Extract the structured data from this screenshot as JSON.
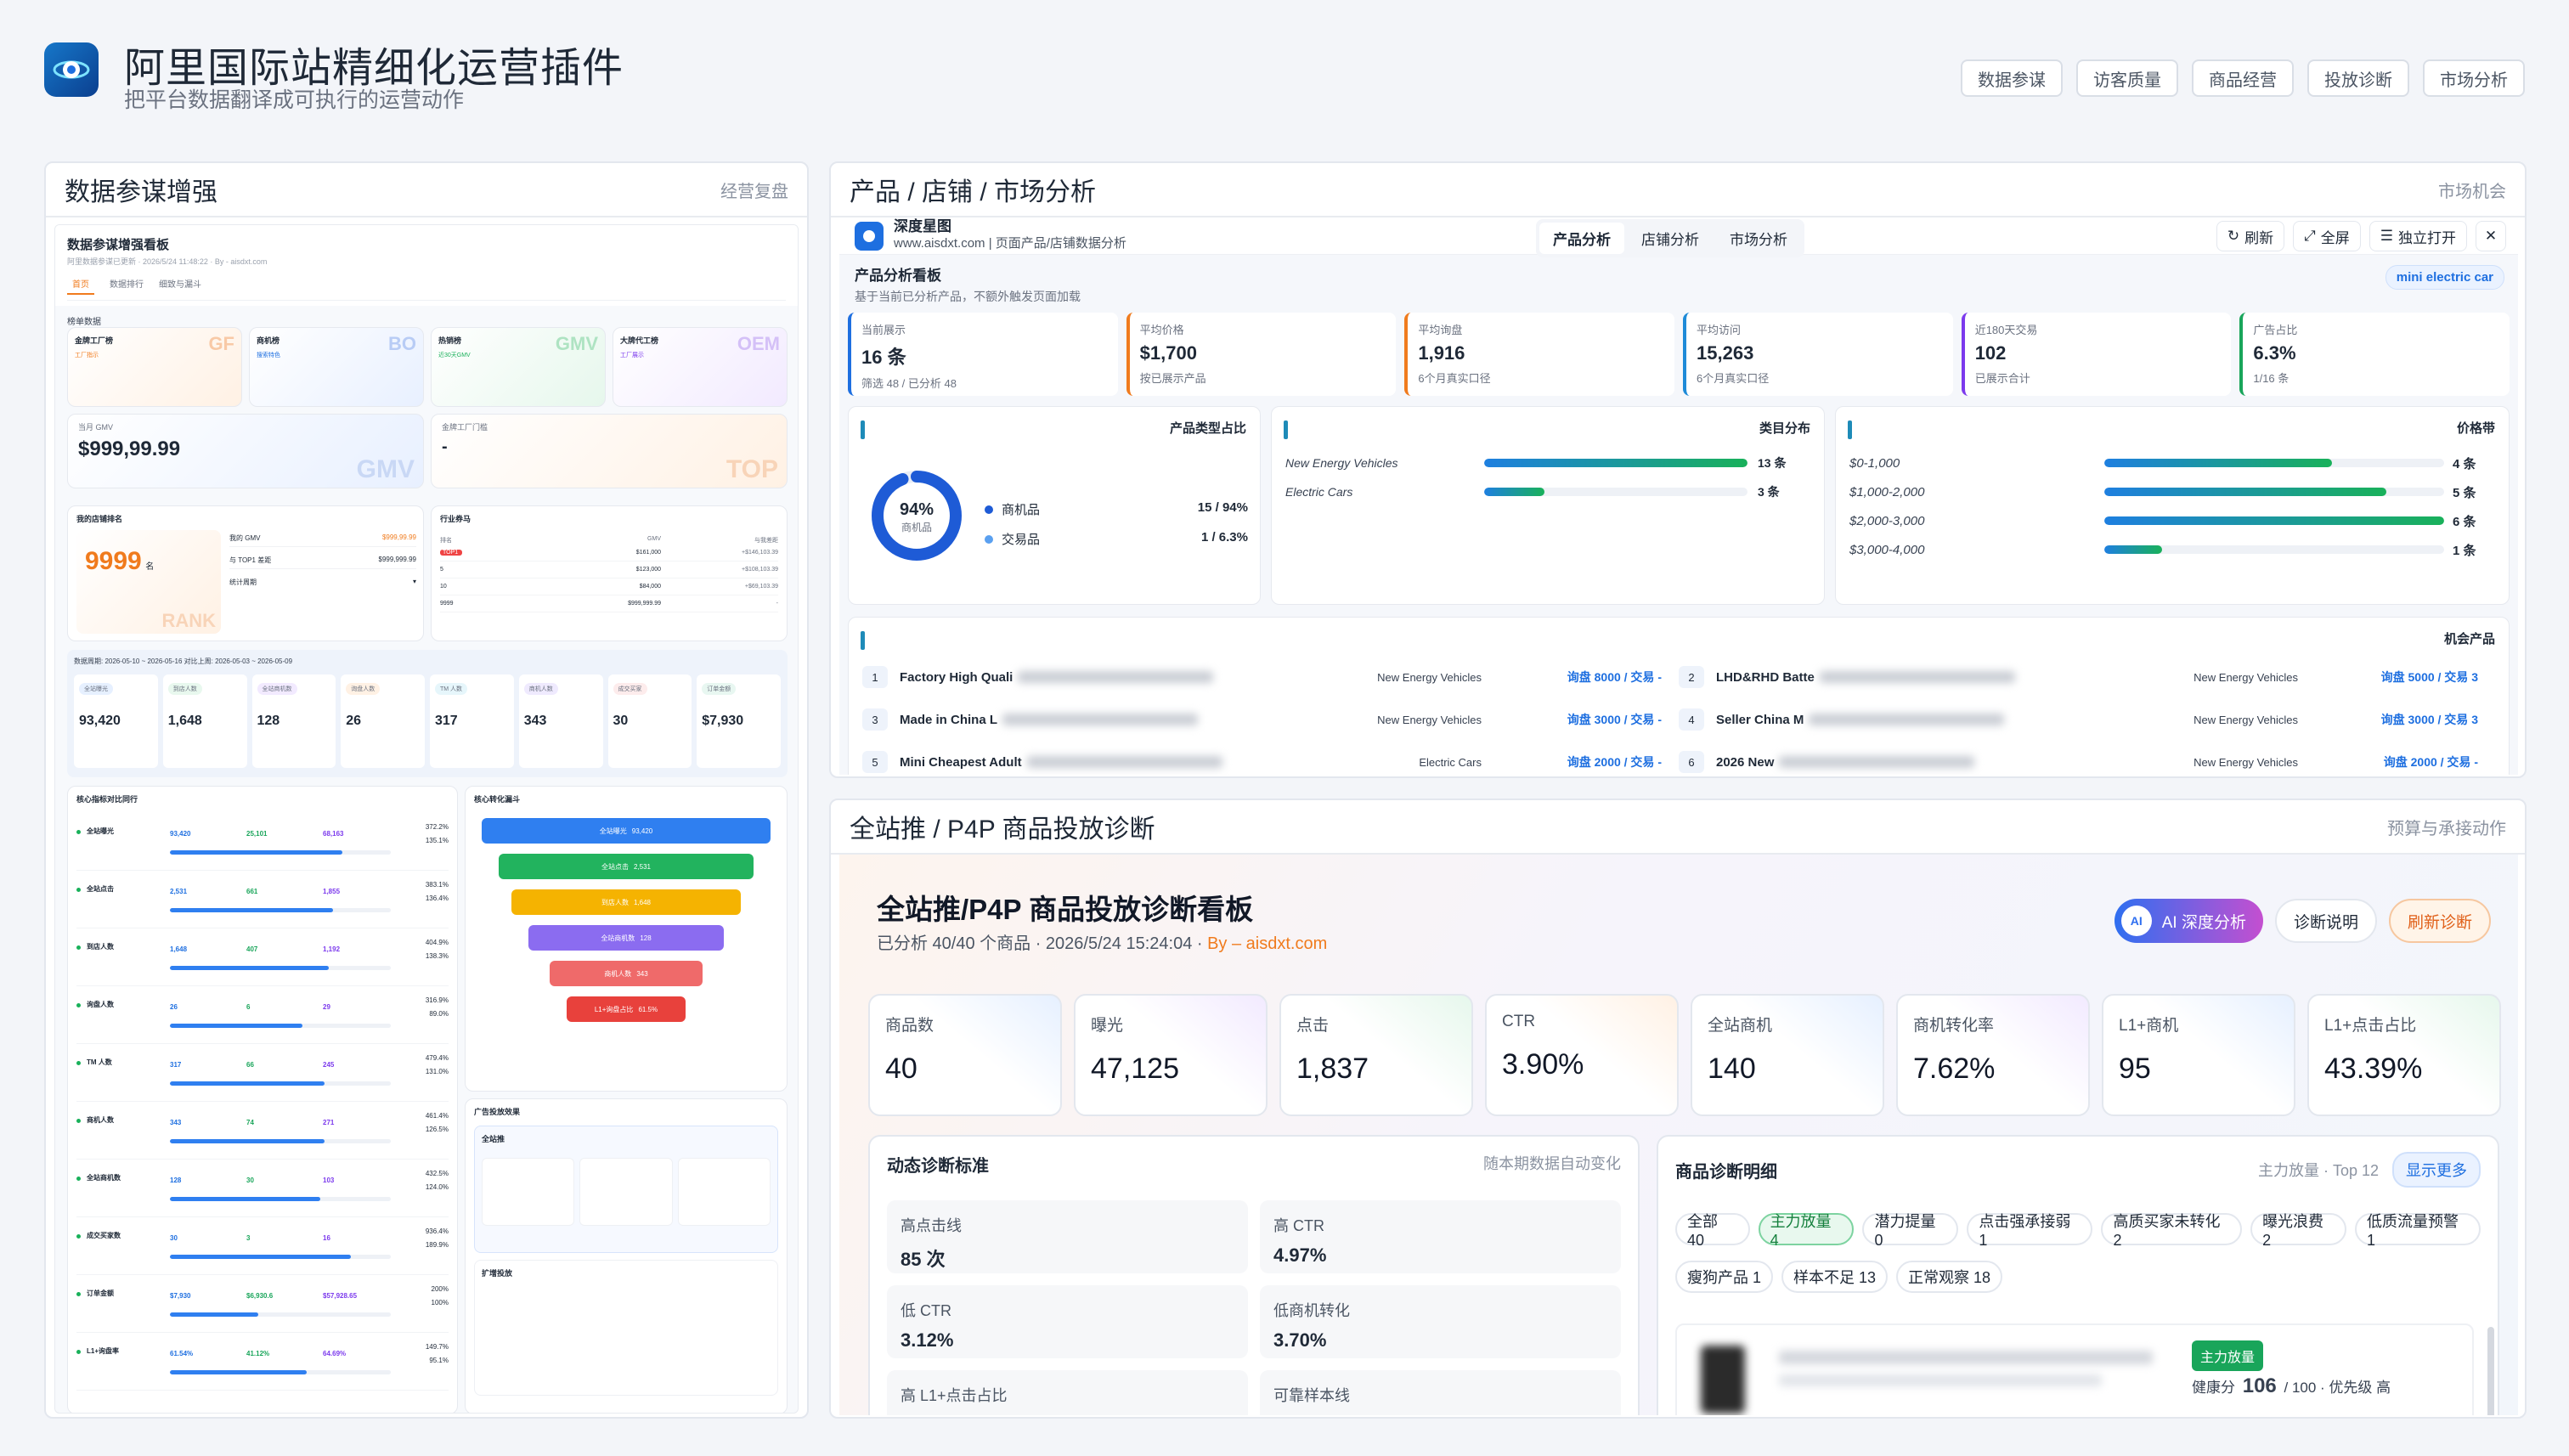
{
  "header": {
    "title": "阿里国际站精细化运营插件",
    "subtitle": "把平台数据翻译成可执行的运营动作",
    "nav": [
      "数据参谋",
      "访客质量",
      "商品经营",
      "投放诊断",
      "市场分析"
    ]
  },
  "left_panel": {
    "title": "数据参谋增强",
    "right": "经营复盘",
    "board_title": "数据参谋增强看板",
    "board_sub": "阿里数据参谋已更新 · 2026/5/24 11:48:22 · By - aisdxt.com",
    "tabs": [
      "首页",
      "数据排行",
      "细致与漏斗"
    ],
    "section_label": "榜单数据",
    "badges": [
      {
        "name": "金牌工厂榜",
        "tag": "工厂指示",
        "wm": "GF"
      },
      {
        "name": "商机榜",
        "tag": "搜索特色",
        "wm": "BO"
      },
      {
        "name": "热销榜",
        "tag": "近30天GMV",
        "wm": "GMV"
      },
      {
        "name": "大牌代工榜",
        "tag": "工厂展示",
        "wm": "OEM"
      }
    ],
    "gmv_label": "当月 GMV",
    "gmv_value": "$999,99.99",
    "gmv_wm": "GMV",
    "factory_label": "金牌工厂门槛",
    "factory_value": "-",
    "factory_wm": "TOP",
    "rank_title": "我的店铺排名",
    "rank_value": "9999",
    "rank_suffix": "名",
    "rank_wm": "RANK",
    "rank_rows": [
      {
        "k": "我的 GMV",
        "v": "$999,99.99"
      },
      {
        "k": "与 TOP1 差距",
        "v": "$999,999.99"
      },
      {
        "k": "统计周期",
        "v": ""
      }
    ],
    "industry_title": "行业券马",
    "industry_head": [
      "排名",
      "GMV",
      "与我差距"
    ],
    "industry_rows": [
      {
        "rank": "TOP1",
        "gmv": "$161,000",
        "diff": "+$146,103.39"
      },
      {
        "rank": "5",
        "gmv": "$123,000",
        "diff": "+$108,103.39"
      },
      {
        "rank": "10",
        "gmv": "$84,000",
        "diff": "+$69,103.39"
      },
      {
        "rank": "9999",
        "gmv": "$999,999.99",
        "diff": "-"
      }
    ],
    "date_range": "数据周期: 2026-05-10 ~ 2026-05-16  对比上周: 2026-05-03 ~ 2026-05-09",
    "mini_kpis": [
      {
        "label": "全站曝光",
        "value": "93,420"
      },
      {
        "label": "到店人数",
        "value": "1,648"
      },
      {
        "label": "全站商机数",
        "value": "128"
      },
      {
        "label": "询盘人数",
        "value": "26"
      },
      {
        "label": "TM 人数",
        "value": "317"
      },
      {
        "label": "商机人数",
        "value": "343"
      },
      {
        "label": "成交买家",
        "value": "30"
      },
      {
        "label": "订单金额",
        "value": "$7,930"
      }
    ],
    "compare_title": "核心指标对比同行",
    "funnel_title": "核心转化漏斗",
    "compare_rows": [
      {
        "name": "全站曝光",
        "me": "93,420",
        "avg": "25,101",
        "top": "68,163",
        "p1": "372.2%",
        "p2": "135.1%",
        "fill": 0.78
      },
      {
        "name": "全站点击",
        "me": "2,531",
        "avg": "661",
        "top": "1,855",
        "p1": "383.1%",
        "p2": "136.4%",
        "fill": 0.74
      },
      {
        "name": "到店人数",
        "me": "1,648",
        "avg": "407",
        "top": "1,192",
        "p1": "404.9%",
        "p2": "138.3%",
        "fill": 0.72
      },
      {
        "name": "询盘人数",
        "me": "26",
        "avg": "6",
        "top": "29",
        "p1": "316.9%",
        "p2": "89.0%",
        "fill": 0.6
      },
      {
        "name": "TM 人数",
        "me": "317",
        "avg": "66",
        "top": "245",
        "p1": "479.4%",
        "p2": "131.0%",
        "fill": 0.7
      },
      {
        "name": "商机人数",
        "me": "343",
        "avg": "74",
        "top": "271",
        "p1": "461.4%",
        "p2": "126.5%",
        "fill": 0.7
      },
      {
        "name": "全站商机数",
        "me": "128",
        "avg": "30",
        "top": "103",
        "p1": "432.5%",
        "p2": "124.0%",
        "fill": 0.68
      },
      {
        "name": "成交买家数",
        "me": "30",
        "avg": "3",
        "top": "16",
        "p1": "936.4%",
        "p2": "189.9%",
        "fill": 0.82
      },
      {
        "name": "订单金额",
        "me": "$7,930",
        "avg": "$6,930.6",
        "top": "$57,928.65",
        "p1": "200%",
        "p2": "100%",
        "fill": 0.4
      },
      {
        "name": "L1+询盘率",
        "me": "61.54%",
        "avg": "41.12%",
        "top": "64.69%",
        "p1": "149.7%",
        "p2": "95.1%",
        "fill": 0.62
      }
    ],
    "funnel": [
      {
        "label": "全站曝光",
        "value": "93,420",
        "color": "#2f7ff0"
      },
      {
        "label": "全站点击",
        "value": "2,531",
        "color": "#22b35e"
      },
      {
        "label": "到店人数",
        "value": "1,648",
        "color": "#f5b301"
      },
      {
        "label": "全站商机数",
        "value": "128",
        "color": "#8b6cf0"
      },
      {
        "label": "商机人数",
        "value": "343",
        "color": "#ef6a6a"
      },
      {
        "label": "L1+询盘占比",
        "value": "61.5%",
        "color": "#e8413c"
      }
    ],
    "ads_title": "广告投放效果",
    "ads_group1": "全站推",
    "ads_group2": "扩增投放"
  },
  "market_panel": {
    "title": "产品 / 店铺 / 市场分析",
    "right": "市场机会",
    "brand": "深度星图",
    "brand_sub": "www.aisdxt.com | 页面产品/店铺数据分析",
    "tabs": [
      "产品分析",
      "店铺分析",
      "市场分析"
    ],
    "actions": [
      "刷新",
      "全屏",
      "独立打开"
    ],
    "close": "✕",
    "board_title": "产品分析看板",
    "board_sub": "基于当前已分析产品，不额外触发页面加载",
    "keyword": "mini electric car",
    "kpis": [
      {
        "label": "当前展示",
        "value": "16 条",
        "sub": "筛选 48 / 已分析 48"
      },
      {
        "label": "平均价格",
        "value": "$1,700",
        "sub": "按已展示产品"
      },
      {
        "label": "平均询盘",
        "value": "1,916",
        "sub": "6个月真实口径"
      },
      {
        "label": "平均访问",
        "value": "15,263",
        "sub": "6个月真实口径"
      },
      {
        "label": "近180天交易",
        "value": "102",
        "sub": "已展示合计"
      },
      {
        "label": "广告占比",
        "value": "6.3%",
        "sub": "1/16 条"
      }
    ],
    "type_title": "产品类型占比",
    "donut_value": "94%",
    "donut_label": "商机品",
    "donut_pct": 0.94,
    "type_legend": [
      {
        "name": "商机品",
        "value": "15 / 94%"
      },
      {
        "name": "交易品",
        "value": "1 / 6.3%"
      }
    ],
    "cat_title": "类目分布",
    "categories": [
      {
        "name": "New Energy Vehicles",
        "value": "13 条",
        "fill": 1.0
      },
      {
        "name": "Electric Cars",
        "value": "3 条",
        "fill": 0.23
      }
    ],
    "price_title": "价格带",
    "price_bands": [
      {
        "name": "$0-1,000",
        "value": "4 条",
        "fill": 0.67
      },
      {
        "name": "$1,000-2,000",
        "value": "5 条",
        "fill": 0.83
      },
      {
        "name": "$2,000-3,000",
        "value": "6 条",
        "fill": 1.0
      },
      {
        "name": "$3,000-4,000",
        "value": "1 条",
        "fill": 0.17
      }
    ],
    "opp_title": "机会产品",
    "opps": [
      {
        "n": "1",
        "name": "Factory High Quali",
        "cat": "New Energy Vehicles",
        "stat": "询盘 8000 / 交易 -"
      },
      {
        "n": "2",
        "name": "LHD&RHD Batte",
        "cat": "New Energy Vehicles",
        "stat": "询盘 5000 / 交易 3"
      },
      {
        "n": "3",
        "name": "Made in China L",
        "cat": "New Energy Vehicles",
        "stat": "询盘 3000 / 交易 -"
      },
      {
        "n": "4",
        "name": "Seller China M",
        "cat": "New Energy Vehicles",
        "stat": "询盘 3000 / 交易 3"
      },
      {
        "n": "5",
        "name": "Mini Cheapest Adult",
        "cat": "Electric Cars",
        "stat": "询盘 2000 / 交易 -"
      },
      {
        "n": "6",
        "name": "2026 New",
        "cat": "New Energy Vehicles",
        "stat": "询盘 2000 / 交易 -"
      }
    ]
  },
  "p4p_panel": {
    "title": "全站推 / P4P 商品投放诊断",
    "right": "预算与承接动作",
    "board_title": "全站推/P4P 商品投放诊断看板",
    "meta_prefix": "已分析 40/40 个商品 · 2026/5/24 15:24:04 · ",
    "meta_by": "By – aisdxt.com",
    "btn_ai_badge": "AI",
    "btn_ai": "AI 深度分析",
    "btn_help": "诊断说明",
    "btn_refresh": "刷新诊断",
    "kpis": [
      {
        "label": "商品数",
        "value": "40"
      },
      {
        "label": "曝光",
        "value": "47,125"
      },
      {
        "label": "点击",
        "value": "1,837"
      },
      {
        "label": "CTR",
        "value": "3.90%"
      },
      {
        "label": "全站商机",
        "value": "140"
      },
      {
        "label": "商机转化率",
        "value": "7.62%"
      },
      {
        "label": "L1+商机",
        "value": "95"
      },
      {
        "label": "L1+点击占比",
        "value": "43.39%"
      }
    ],
    "dyn_title": "动态诊断标准",
    "dyn_right": "随本期数据自动变化",
    "dyn_items": [
      {
        "label": "高点击线",
        "value": "85 次"
      },
      {
        "label": "高 CTR",
        "value": "4.97%"
      },
      {
        "label": "低 CTR",
        "value": "3.12%"
      },
      {
        "label": "低商机转化",
        "value": "3.70%"
      },
      {
        "label": "高 L1+点击占比",
        "value": ""
      },
      {
        "label": "可靠样本线",
        "value": ""
      }
    ],
    "detail_title": "商品诊断明细",
    "detail_right": "主力放量 · Top 12",
    "detail_more": "显示更多",
    "chips_row1": [
      {
        "label": "全部 40",
        "active": false
      },
      {
        "label": "主力放量 4",
        "active": true
      },
      {
        "label": "潜力提量 0",
        "active": false
      },
      {
        "label": "点击强承接弱 1",
        "active": false
      },
      {
        "label": "高质买家未转化 2",
        "active": false
      },
      {
        "label": "曝光浪费 2",
        "active": false
      },
      {
        "label": "低质流量预警 1",
        "active": false
      }
    ],
    "chips_row2": [
      {
        "label": "瘦狗产品 1",
        "active": false
      },
      {
        "label": "样本不足 13",
        "active": false
      },
      {
        "label": "正常观察 18",
        "active": false
      }
    ],
    "item_tag": "主力放量",
    "item_score_label": "健康分",
    "item_score": "106",
    "item_score_rest": "/ 100 · 优先级 高"
  },
  "colors": {
    "primary": "#1e6fe0",
    "green": "#19b15a",
    "orange": "#f07b1d",
    "purple": "#7c3aed"
  }
}
